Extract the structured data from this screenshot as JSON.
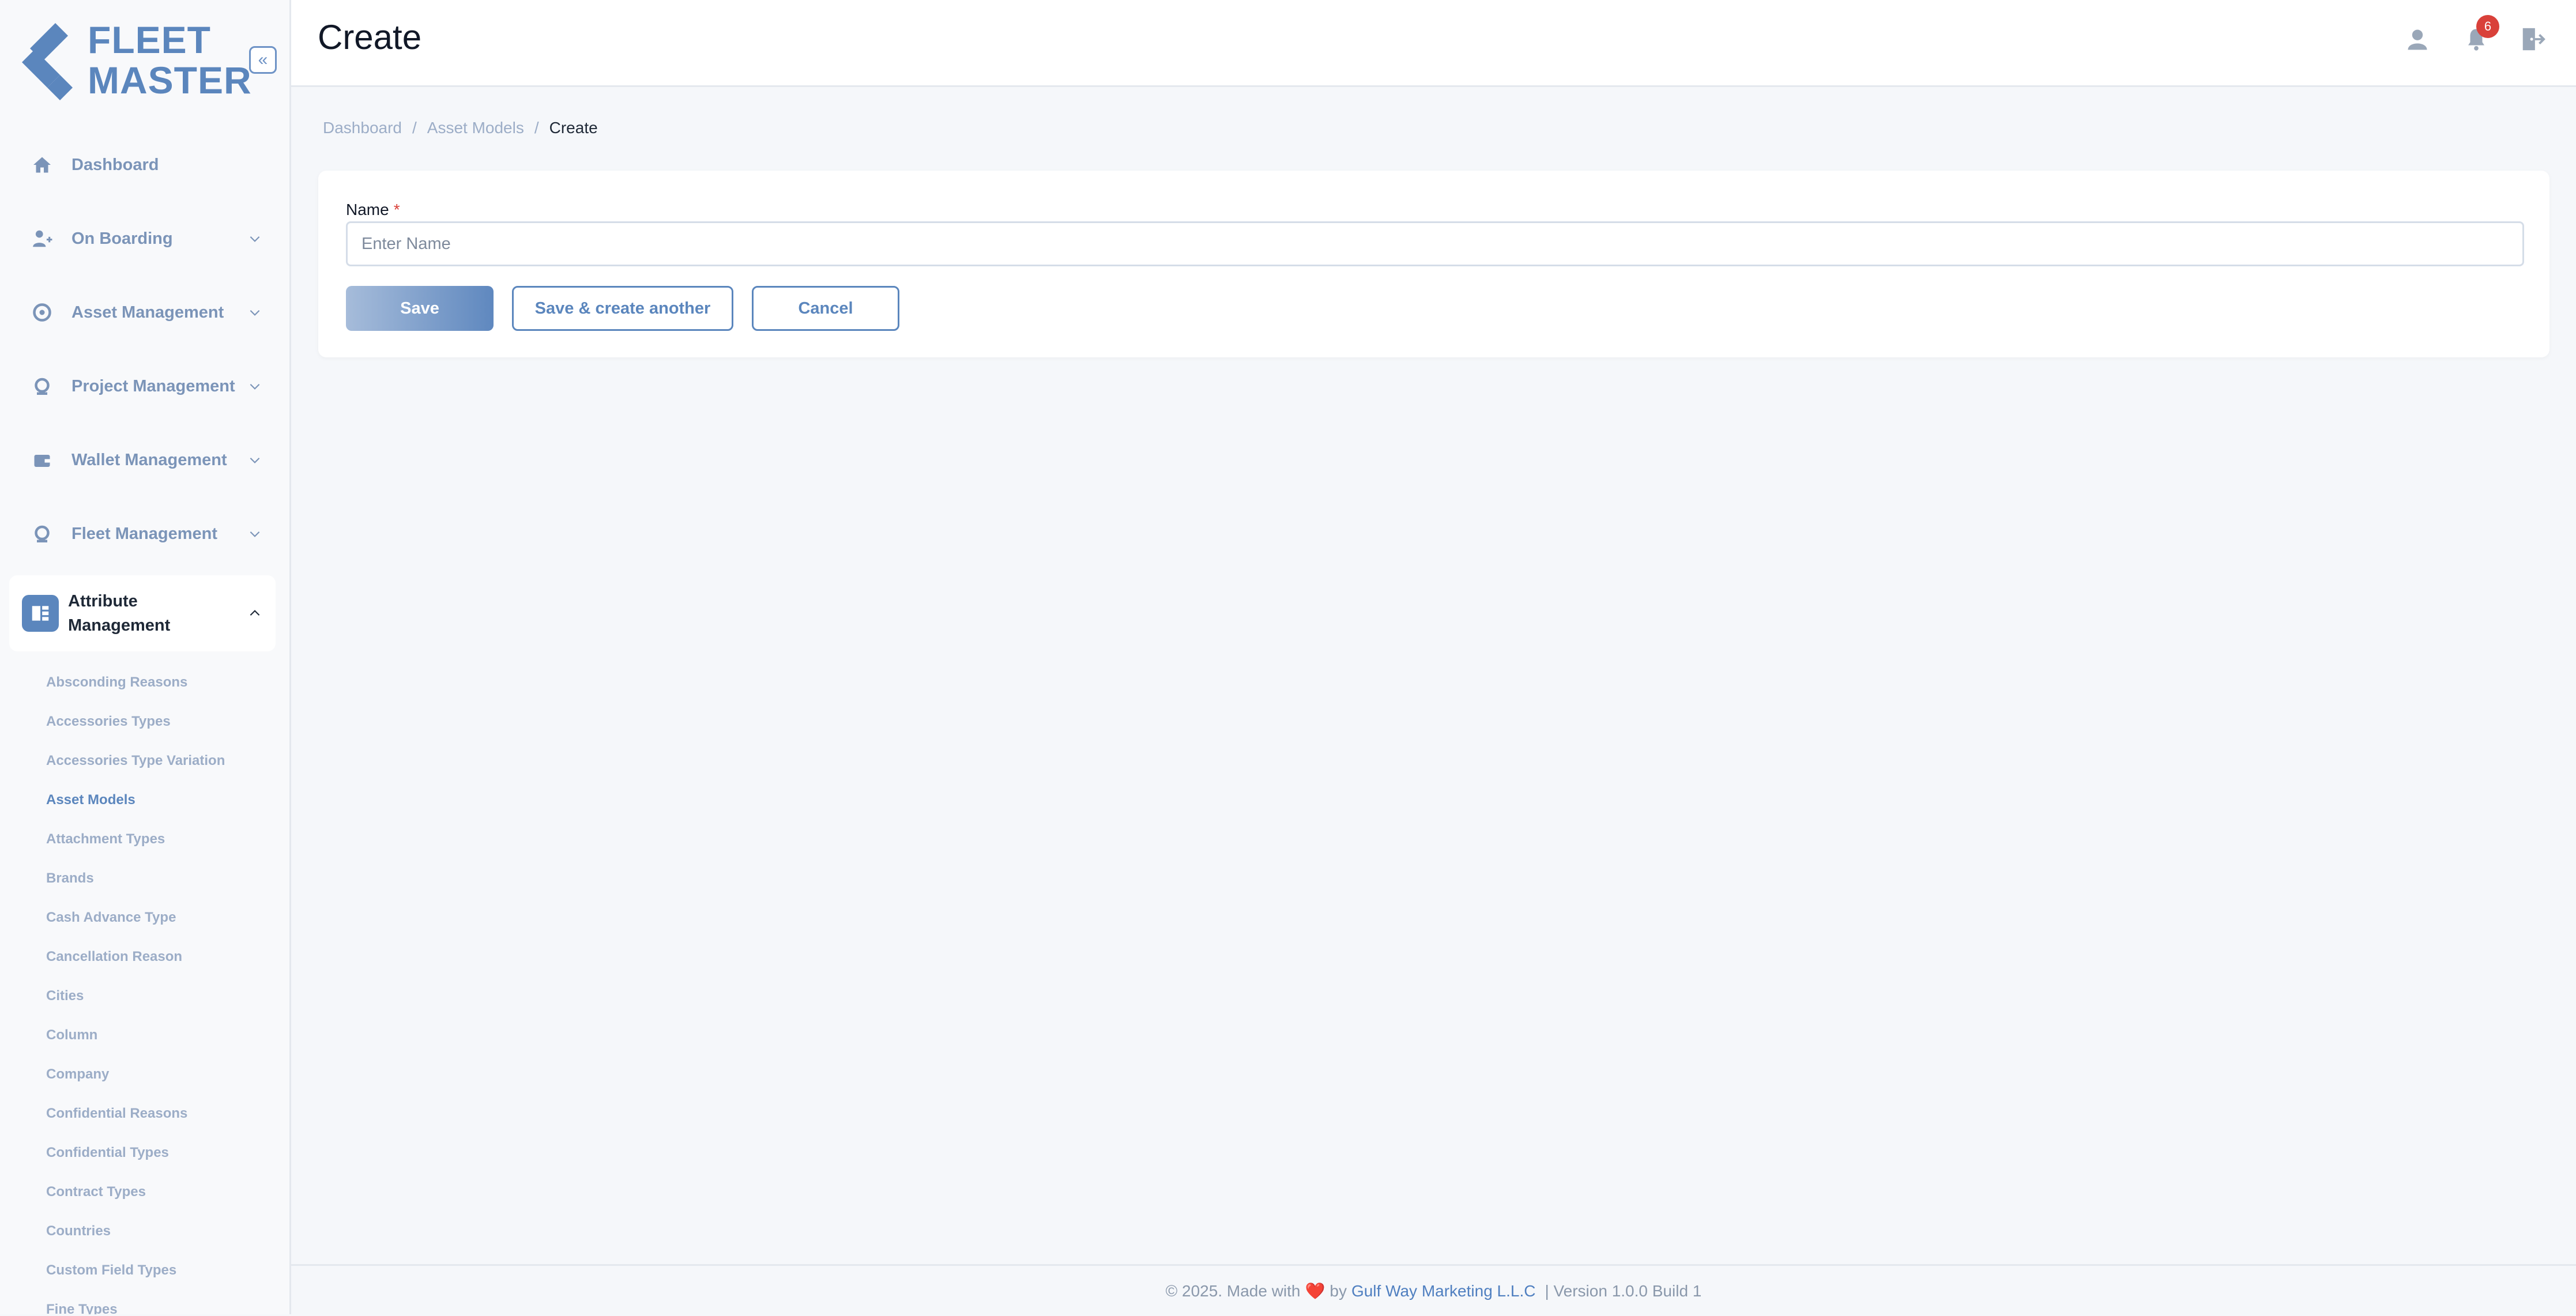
{
  "app": {
    "logo_line1": "FLEET",
    "logo_line2": "MASTER",
    "accent_color": "#5b86bd"
  },
  "sidebar": {
    "collapse_icon": "chevrons-left-icon",
    "items": [
      {
        "label": "Dashboard",
        "icon": "home-icon"
      },
      {
        "label": "On Boarding",
        "icon": "user-plus-icon"
      },
      {
        "label": "Asset Management",
        "icon": "asset-icon"
      },
      {
        "label": "Project Management",
        "icon": "project-icon"
      },
      {
        "label": "Wallet Management",
        "icon": "wallet-icon"
      },
      {
        "label": "Fleet Management",
        "icon": "fleet-icon"
      },
      {
        "label": "Attribute Management",
        "icon": "attribute-icon"
      }
    ],
    "sub_items": [
      "Absconding Reasons",
      "Accessories Types",
      "Accessories Type Variation",
      "Asset Models",
      "Attachment Types",
      "Brands",
      "Cash Advance Type",
      "Cancellation Reason",
      "Cities",
      "Column",
      "Company",
      "Confidential Reasons",
      "Confidential Types",
      "Contract Types",
      "Countries",
      "Custom Field Types",
      "Fine Types"
    ]
  },
  "header": {
    "title": "Create",
    "notification_count": "6"
  },
  "breadcrumb": {
    "items": [
      "Dashboard",
      "Asset Models",
      "Create"
    ]
  },
  "form": {
    "name_label": "Name",
    "required_mark": "*",
    "name_value": "",
    "name_placeholder": "Enter Name",
    "save_label": "Save",
    "save_another_label": "Save & create another",
    "cancel_label": "Cancel"
  },
  "footer": {
    "prefix": "© 2025. Made with",
    "heart": "❤️",
    "by": "by",
    "company": "Gulf Way Marketing L.L.C",
    "version": "| Version 1.0.0 Build 1"
  }
}
